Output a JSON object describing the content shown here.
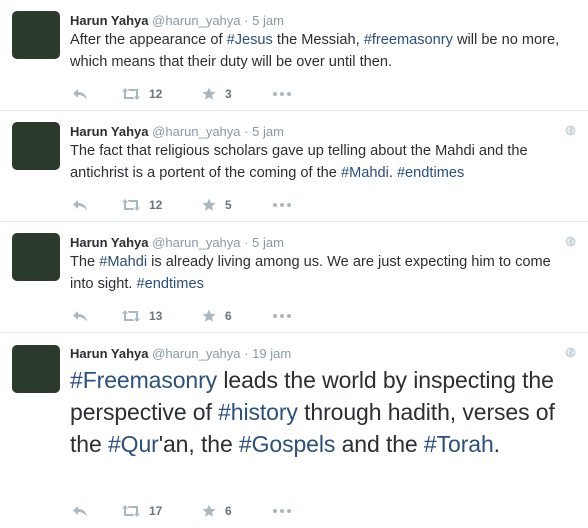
{
  "tweets": [
    {
      "fullname": "Harun Yahya",
      "username": "@harun_yahya",
      "separator": "·",
      "time": "5 jam",
      "size": "normal",
      "segments": [
        {
          "t": "After the appearance of "
        },
        {
          "t": "#Jesus",
          "tag": true
        },
        {
          "t": " the Messiah, "
        },
        {
          "t": "#freemasonry",
          "tag": true
        },
        {
          "t": " will be no more, which means that their duty will be over until then."
        }
      ],
      "retweets": "12",
      "favorites": "3"
    },
    {
      "fullname": "Harun Yahya",
      "username": "@harun_yahya",
      "separator": "·",
      "time": "5 jam",
      "size": "normal",
      "segments": [
        {
          "t": "The fact that religious scholars gave up telling about the Mahdi and the antichrist is a portent of the coming of the "
        },
        {
          "t": "#Mahdi",
          "tag": true
        },
        {
          "t": ". "
        },
        {
          "t": "#endtimes",
          "tag": true
        }
      ],
      "retweets": "12",
      "favorites": "5"
    },
    {
      "fullname": "Harun Yahya",
      "username": "@harun_yahya",
      "separator": "·",
      "time": "5 jam",
      "size": "normal",
      "segments": [
        {
          "t": "The "
        },
        {
          "t": "#Mahdi",
          "tag": true
        },
        {
          "t": " is already living among us. We are just expecting him to come into sight. "
        },
        {
          "t": "#endtimes",
          "tag": true
        }
      ],
      "retweets": "13",
      "favorites": "6"
    },
    {
      "fullname": "Harun Yahya",
      "username": "@harun_yahya",
      "separator": "·",
      "time": "19 jam",
      "size": "large",
      "segments": [
        {
          "t": "#Freemasonry",
          "tag": true
        },
        {
          "t": " leads the world by inspecting the perspective of "
        },
        {
          "t": "#history",
          "tag": true
        },
        {
          "t": " through hadith, verses of the "
        },
        {
          "t": "#Qur",
          "tag": true
        },
        {
          "t": "'an, the "
        },
        {
          "t": "#Gospels",
          "tag": true
        },
        {
          "t": " and the "
        },
        {
          "t": "#Torah",
          "tag": true
        },
        {
          "t": "."
        }
      ],
      "retweets": "17",
      "favorites": "6"
    }
  ],
  "icons": {
    "reply": "reply-icon",
    "retweet": "retweet-icon",
    "favorite": "star-icon",
    "more": "more-icon",
    "globe": "globe-icon"
  },
  "colors": {
    "hashtag": "#2b4f7e",
    "meta": "#8899a6",
    "text": "#292f33",
    "divider": "#e1e8ed"
  }
}
